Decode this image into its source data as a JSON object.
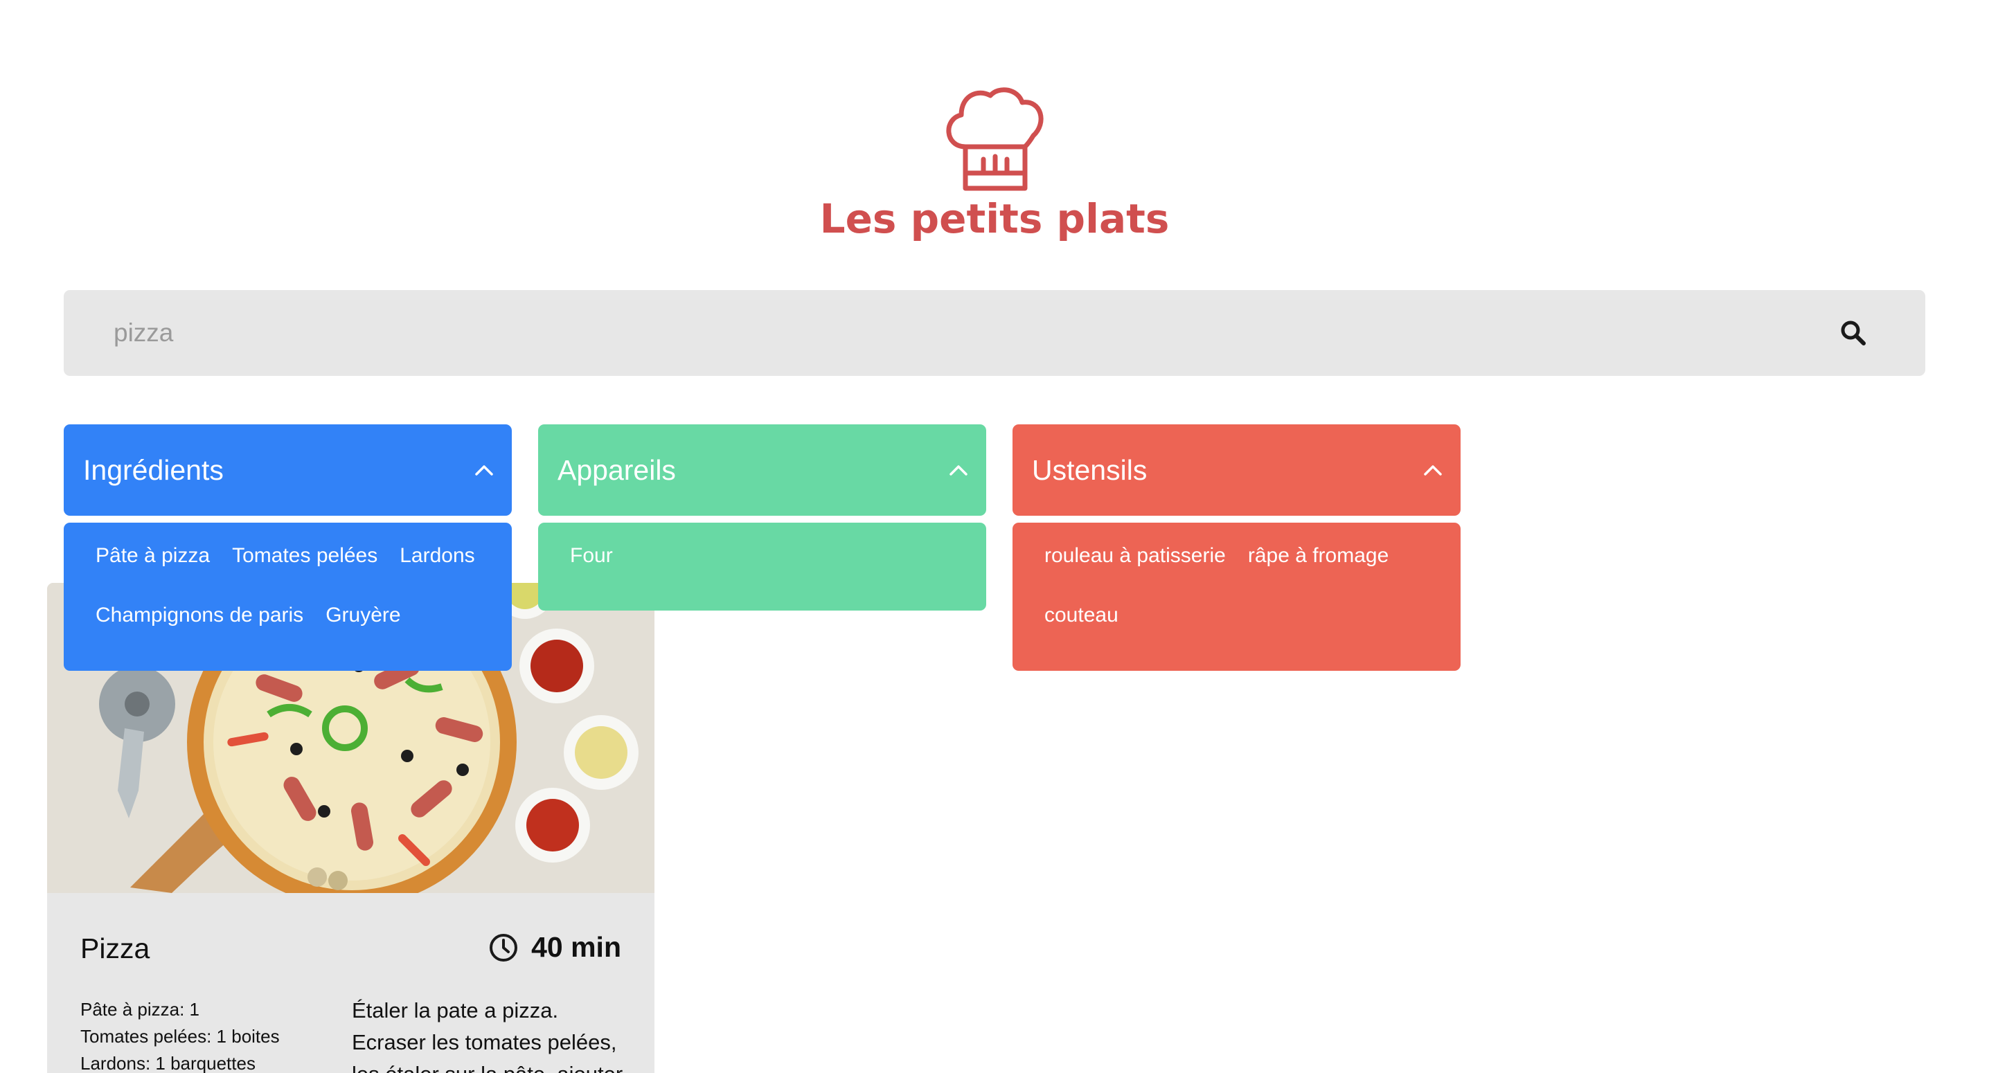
{
  "header": {
    "title": "Les petits plats",
    "logo_icon": "chef-hat-icon"
  },
  "search": {
    "placeholder": "pizza",
    "value": "",
    "icon": "search-icon"
  },
  "filters": [
    {
      "label": "Ingrédients",
      "color": "#3282F7",
      "open": true,
      "items": [
        "Pâte à pizza",
        "Tomates pelées",
        "Lardons",
        "Champignons de paris",
        "Gruyère"
      ]
    },
    {
      "label": "Appareils",
      "color": "#68D9A4",
      "open": true,
      "items": [
        "Four"
      ]
    },
    {
      "label": "Ustensils",
      "color": "#ED6454",
      "open": true,
      "items": [
        "rouleau à patisserie",
        "râpe à fromage",
        "couteau"
      ]
    }
  ],
  "recipe": {
    "title": "Pizza",
    "time": "40 min",
    "ingredients": [
      "Pâte à pizza: 1",
      "Tomates pelées: 1 boites",
      "Lardons: 1 barquettes"
    ],
    "description": "Étaler la pate a pizza. Ecraser les tomates pelées, les étaler sur la pâte, ajouter les"
  },
  "colors": {
    "brand": "#D04F4F",
    "search_bg": "#E7E7E7",
    "card_bg": "#E7E7E7"
  }
}
